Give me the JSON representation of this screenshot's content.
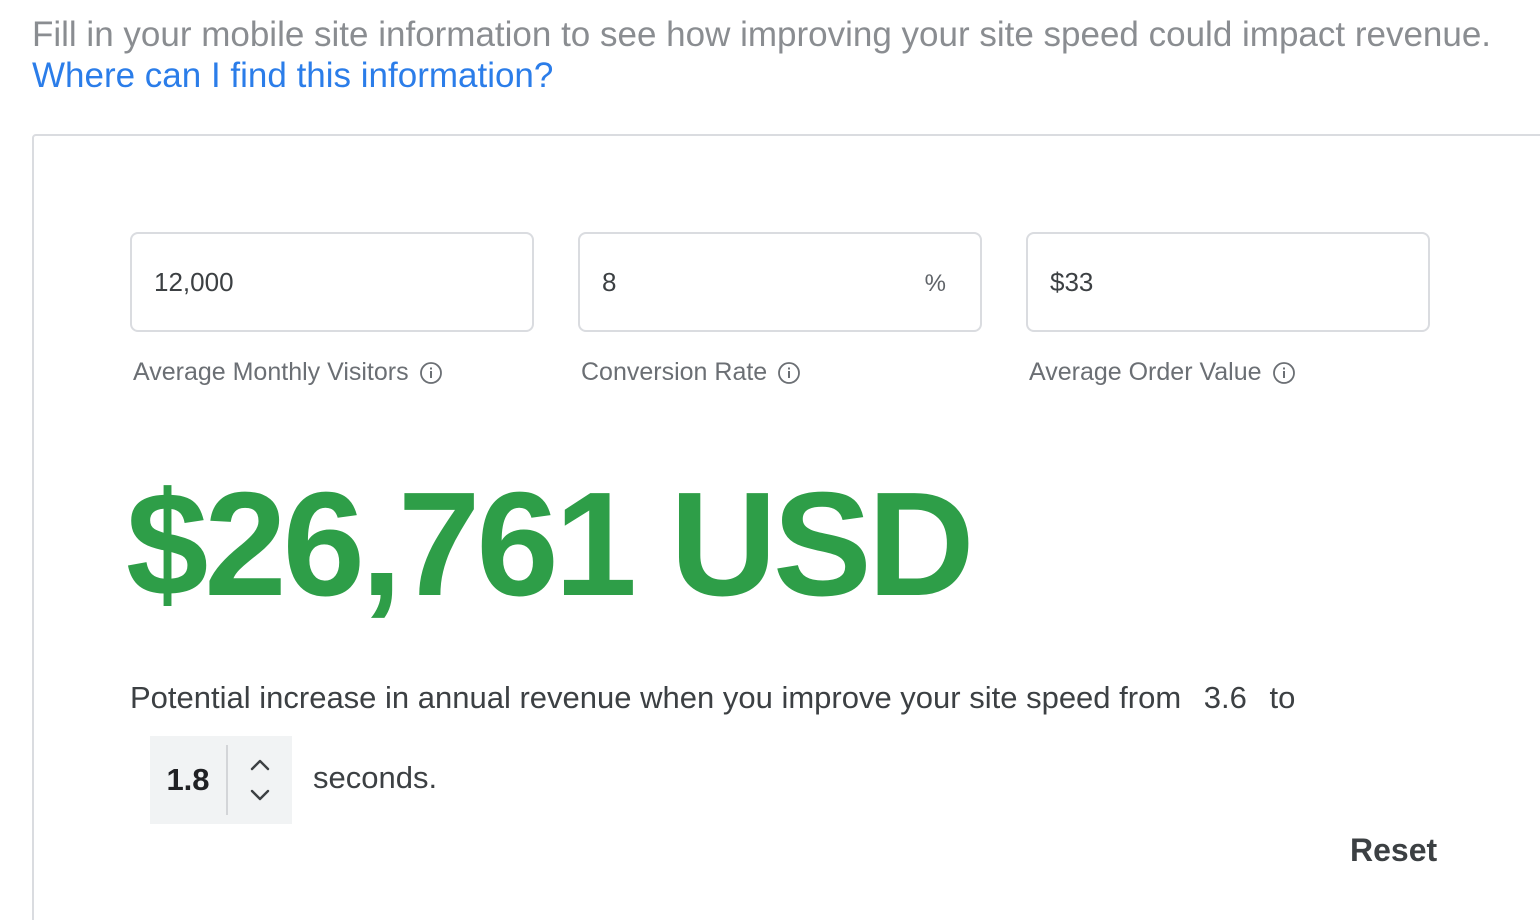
{
  "intro": {
    "text": "Fill in your mobile site information to see how improving your site speed could impact revenue.",
    "link_label": "Where can I find this information?"
  },
  "fields": [
    {
      "value": "12,000",
      "label": "Average Monthly Visitors",
      "suffix": ""
    },
    {
      "value": "8",
      "label": "Conversion Rate",
      "suffix": "%"
    },
    {
      "value": "$33",
      "label": "Average Order Value",
      "suffix": ""
    }
  ],
  "result": {
    "amount": "$26,761 USD"
  },
  "description": {
    "text": "Potential increase in annual revenue when you improve your site speed from",
    "from_value": "3.6",
    "to_word": "to",
    "target_value": "1.8",
    "unit": "seconds."
  },
  "actions": {
    "reset_label": "Reset"
  },
  "colors": {
    "accent_green": "#2e9e48",
    "link_blue": "#2b7de9",
    "muted_text": "#8a8d91"
  },
  "icons": {
    "info": "info-icon",
    "up": "chevron-up-icon",
    "down": "chevron-down-icon"
  }
}
